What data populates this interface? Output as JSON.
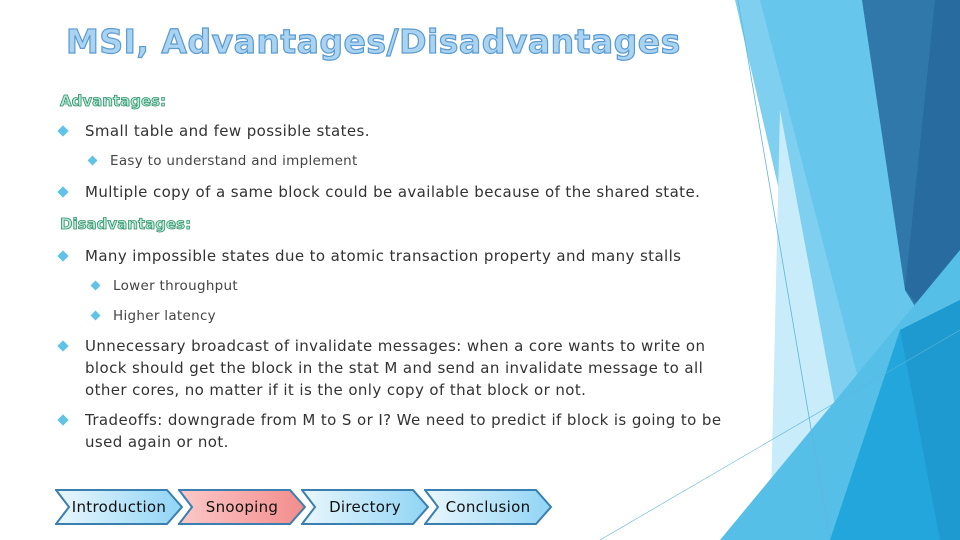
{
  "slide": {
    "title": "MSI, Advantages/Disadvantages",
    "advantages_heading": "Advantages:",
    "advantages": [
      {
        "text": "Small table and few possible states.",
        "subitems": [
          "Easy to understand and implement"
        ]
      },
      {
        "text": "Multiple copy of a same block could be available because of the shared state.",
        "subitems": []
      }
    ],
    "disadvantages_heading": "Disadvantages:",
    "disadvantages": [
      {
        "text": "Many impossible states due to atomic transaction property and many stalls",
        "subitems": [
          "Lower throughput",
          "Higher latency"
        ]
      },
      {
        "text": "Unnecessary broadcast of invalidate messages: when a core wants to write on block should get the block in the stat M and send an invalidate message to all other cores, no matter if it is the only copy of that block or not.",
        "subitems": []
      },
      {
        "text": "Tradeoffs: downgrade from M to S or I? We need to predict if block is going to be used again or not.",
        "subitems": []
      }
    ]
  },
  "nav": {
    "items": [
      {
        "label": "Introduction",
        "active": false
      },
      {
        "label": "Snooping",
        "active": true
      },
      {
        "label": "Directory",
        "active": false
      },
      {
        "label": "Conclusion",
        "active": false
      }
    ],
    "colors": {
      "inactive": "#bfe6f8",
      "active": "#f8a0a0",
      "border": "#3a7fb0"
    }
  },
  "theme": {
    "bullet_color": "#5fc2e6",
    "title_color": "#a9d3f0",
    "heading_color": "#2f8f6a"
  }
}
